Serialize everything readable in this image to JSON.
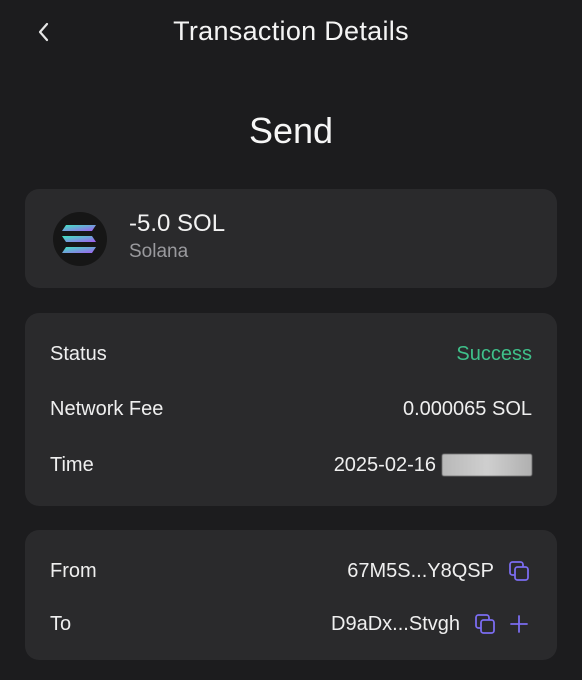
{
  "header": {
    "title": "Transaction Details"
  },
  "page": {
    "heading": "Send"
  },
  "asset": {
    "amount": "-5.0 SOL",
    "token_name": "Solana"
  },
  "details": {
    "status_label": "Status",
    "status_value": "Success",
    "fee_label": "Network Fee",
    "fee_value": "0.000065 SOL",
    "time_label": "Time",
    "time_value": "2025-02-16"
  },
  "addresses": {
    "from_label": "From",
    "from_value": "67M5S...Y8QSP",
    "to_label": "To",
    "to_value": "D9aDx...Stvgh"
  },
  "colors": {
    "background": "#1c1c1e",
    "card": "#2a2a2c",
    "success": "#3fc08a",
    "accent_icon": "#7b6cf0"
  },
  "icons": [
    "chevron-left-icon",
    "solana-logo-icon",
    "copy-icon",
    "plus-icon"
  ]
}
